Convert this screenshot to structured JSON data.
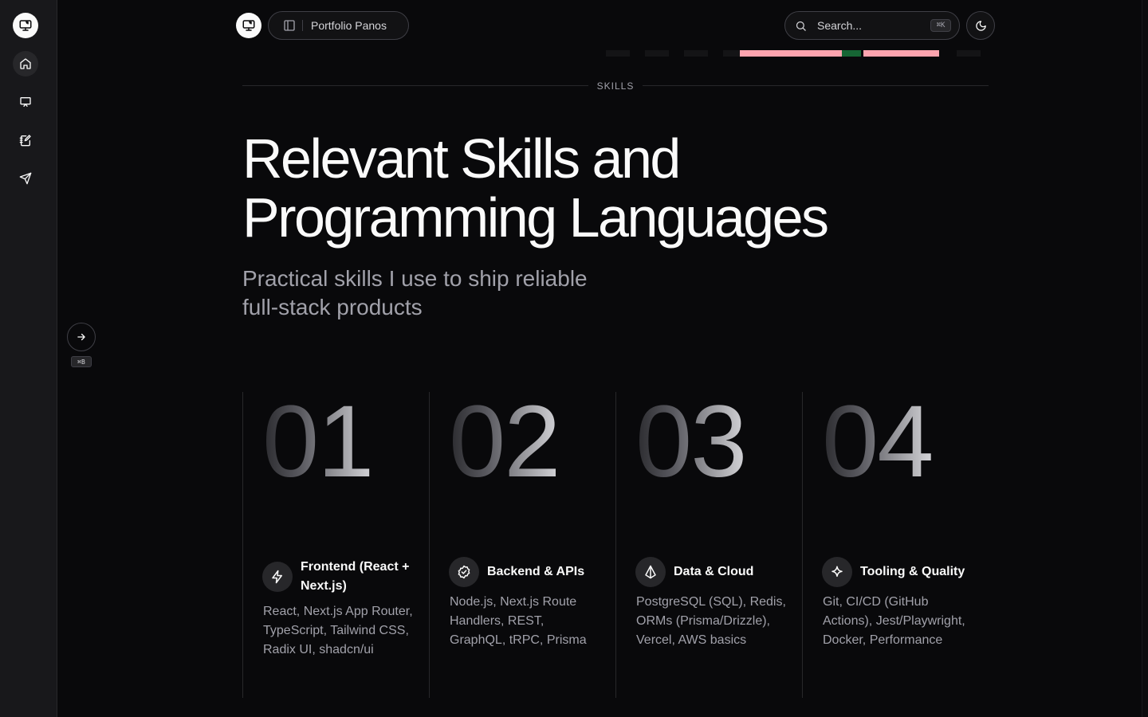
{
  "header": {
    "breadcrumb": "Portfolio Panos",
    "search_placeholder": "Search...",
    "search_shortcut": "⌘K"
  },
  "sidebar": {
    "toggle_shortcut": "⌘B",
    "items": [
      {
        "icon": "home-icon",
        "active": true
      },
      {
        "icon": "presentation-icon",
        "active": false
      },
      {
        "icon": "notebook-pen-icon",
        "active": false
      },
      {
        "icon": "send-icon",
        "active": false
      }
    ]
  },
  "section": {
    "label": "SKILLS",
    "title_line1": "Relevant Skills and",
    "title_line2": "Programming Languages",
    "subtitle_line1": "Practical skills I use to ship reliable",
    "subtitle_line2": "full-stack products"
  },
  "cards": [
    {
      "number": "01",
      "icon": "zap-icon",
      "title": "Frontend (React + Next.js)",
      "description": "React, Next.js App Router, TypeScript, Tailwind CSS, Radix UI, shadcn/ui"
    },
    {
      "number": "02",
      "icon": "badge-check-icon",
      "title": "Backend & APIs",
      "description": "Node.js, Next.js Route Handlers, REST, GraphQL, tRPC, Prisma"
    },
    {
      "number": "03",
      "icon": "prisma-icon",
      "title": "Data & Cloud",
      "description": "PostgreSQL (SQL), Redis, ORMs (Prisma/Drizzle), Vercel, AWS basics"
    },
    {
      "number": "04",
      "icon": "sparkle-icon",
      "title": "Tooling & Quality",
      "description": "Git, CI/CD (GitHub Actions), Jest/Playwright, Docker, Performance"
    }
  ],
  "colors": {
    "background": "#09090b",
    "rail": "#18181b",
    "border": "#27272a",
    "text": "#fafafa",
    "muted": "#a1a1aa",
    "accent_strip": "#fda4af"
  }
}
